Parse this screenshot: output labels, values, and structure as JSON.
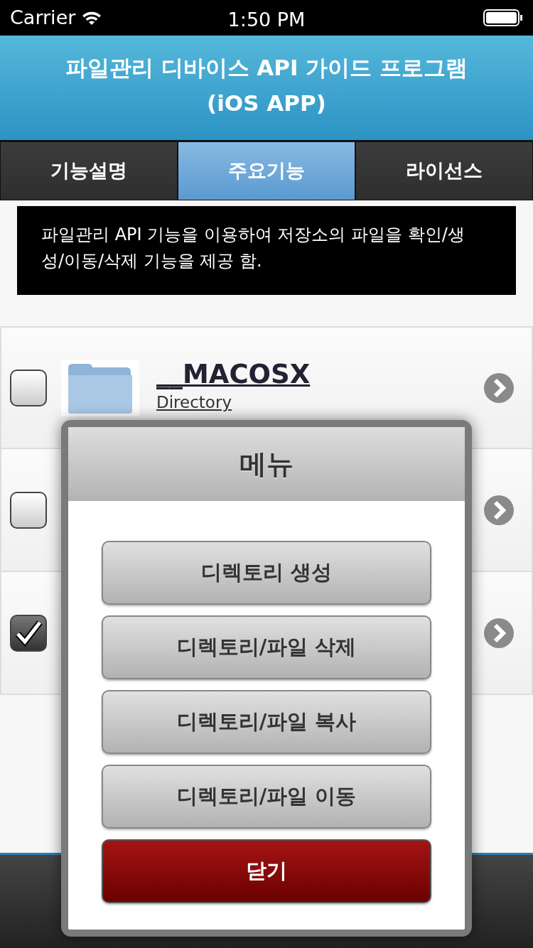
{
  "status_bar": {
    "carrier": "Carrier",
    "time": "1:50 PM"
  },
  "header": {
    "title_lines": [
      "파일관리 디바이스 API 가이드 프로그램",
      "(iOS APP)"
    ]
  },
  "tabs": [
    {
      "label": "기능설명",
      "selected": false
    },
    {
      "label": "주요기능",
      "selected": true
    },
    {
      "label": "라이선스",
      "selected": false
    }
  ],
  "description": "파일관리 API 기능을 이용하여 저장소의 파일을 확인/생성/이동/삭제 기능을 제공 함.",
  "files": [
    {
      "checked": false,
      "name": "__MACOSX",
      "detail": "Directory"
    },
    {
      "checked": false
    },
    {
      "checked": true
    }
  ],
  "menu": {
    "title": "메뉴",
    "buttons": [
      {
        "label": "디렉토리 생성",
        "kind": "default"
      },
      {
        "label": "디렉토리/파일 삭제",
        "kind": "default"
      },
      {
        "label": "디렉토리/파일 복사",
        "kind": "default"
      },
      {
        "label": "디렉토리/파일 이동",
        "kind": "default"
      },
      {
        "label": "닫기",
        "kind": "danger"
      }
    ]
  }
}
